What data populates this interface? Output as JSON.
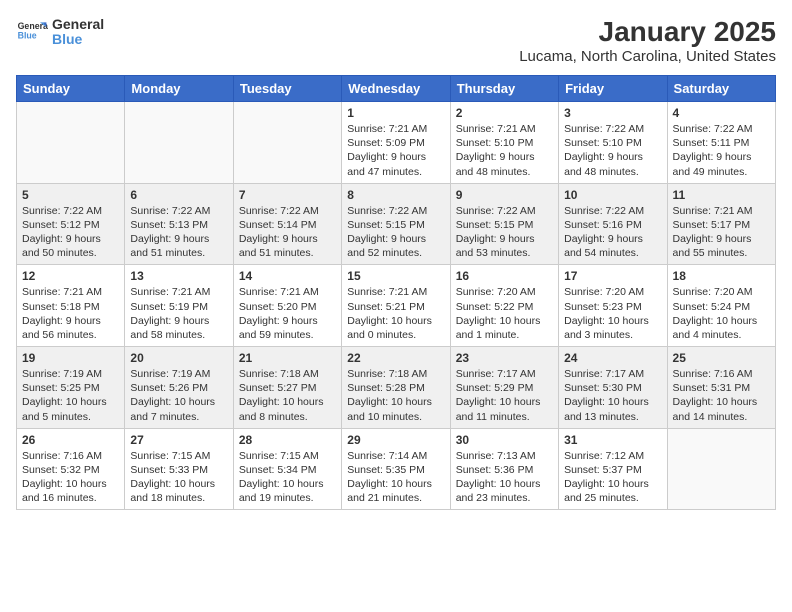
{
  "header": {
    "logo_line1": "General",
    "logo_line2": "Blue",
    "title": "January 2025",
    "subtitle": "Lucama, North Carolina, United States"
  },
  "days_of_week": [
    "Sunday",
    "Monday",
    "Tuesday",
    "Wednesday",
    "Thursday",
    "Friday",
    "Saturday"
  ],
  "weeks": [
    [
      {
        "day": "",
        "content": ""
      },
      {
        "day": "",
        "content": ""
      },
      {
        "day": "",
        "content": ""
      },
      {
        "day": "1",
        "content": "Sunrise: 7:21 AM\nSunset: 5:09 PM\nDaylight: 9 hours and 47 minutes."
      },
      {
        "day": "2",
        "content": "Sunrise: 7:21 AM\nSunset: 5:10 PM\nDaylight: 9 hours and 48 minutes."
      },
      {
        "day": "3",
        "content": "Sunrise: 7:22 AM\nSunset: 5:10 PM\nDaylight: 9 hours and 48 minutes."
      },
      {
        "day": "4",
        "content": "Sunrise: 7:22 AM\nSunset: 5:11 PM\nDaylight: 9 hours and 49 minutes."
      }
    ],
    [
      {
        "day": "5",
        "content": "Sunrise: 7:22 AM\nSunset: 5:12 PM\nDaylight: 9 hours and 50 minutes."
      },
      {
        "day": "6",
        "content": "Sunrise: 7:22 AM\nSunset: 5:13 PM\nDaylight: 9 hours and 51 minutes."
      },
      {
        "day": "7",
        "content": "Sunrise: 7:22 AM\nSunset: 5:14 PM\nDaylight: 9 hours and 51 minutes."
      },
      {
        "day": "8",
        "content": "Sunrise: 7:22 AM\nSunset: 5:15 PM\nDaylight: 9 hours and 52 minutes."
      },
      {
        "day": "9",
        "content": "Sunrise: 7:22 AM\nSunset: 5:15 PM\nDaylight: 9 hours and 53 minutes."
      },
      {
        "day": "10",
        "content": "Sunrise: 7:22 AM\nSunset: 5:16 PM\nDaylight: 9 hours and 54 minutes."
      },
      {
        "day": "11",
        "content": "Sunrise: 7:21 AM\nSunset: 5:17 PM\nDaylight: 9 hours and 55 minutes."
      }
    ],
    [
      {
        "day": "12",
        "content": "Sunrise: 7:21 AM\nSunset: 5:18 PM\nDaylight: 9 hours and 56 minutes."
      },
      {
        "day": "13",
        "content": "Sunrise: 7:21 AM\nSunset: 5:19 PM\nDaylight: 9 hours and 58 minutes."
      },
      {
        "day": "14",
        "content": "Sunrise: 7:21 AM\nSunset: 5:20 PM\nDaylight: 9 hours and 59 minutes."
      },
      {
        "day": "15",
        "content": "Sunrise: 7:21 AM\nSunset: 5:21 PM\nDaylight: 10 hours and 0 minutes."
      },
      {
        "day": "16",
        "content": "Sunrise: 7:20 AM\nSunset: 5:22 PM\nDaylight: 10 hours and 1 minute."
      },
      {
        "day": "17",
        "content": "Sunrise: 7:20 AM\nSunset: 5:23 PM\nDaylight: 10 hours and 3 minutes."
      },
      {
        "day": "18",
        "content": "Sunrise: 7:20 AM\nSunset: 5:24 PM\nDaylight: 10 hours and 4 minutes."
      }
    ],
    [
      {
        "day": "19",
        "content": "Sunrise: 7:19 AM\nSunset: 5:25 PM\nDaylight: 10 hours and 5 minutes."
      },
      {
        "day": "20",
        "content": "Sunrise: 7:19 AM\nSunset: 5:26 PM\nDaylight: 10 hours and 7 minutes."
      },
      {
        "day": "21",
        "content": "Sunrise: 7:18 AM\nSunset: 5:27 PM\nDaylight: 10 hours and 8 minutes."
      },
      {
        "day": "22",
        "content": "Sunrise: 7:18 AM\nSunset: 5:28 PM\nDaylight: 10 hours and 10 minutes."
      },
      {
        "day": "23",
        "content": "Sunrise: 7:17 AM\nSunset: 5:29 PM\nDaylight: 10 hours and 11 minutes."
      },
      {
        "day": "24",
        "content": "Sunrise: 7:17 AM\nSunset: 5:30 PM\nDaylight: 10 hours and 13 minutes."
      },
      {
        "day": "25",
        "content": "Sunrise: 7:16 AM\nSunset: 5:31 PM\nDaylight: 10 hours and 14 minutes."
      }
    ],
    [
      {
        "day": "26",
        "content": "Sunrise: 7:16 AM\nSunset: 5:32 PM\nDaylight: 10 hours and 16 minutes."
      },
      {
        "day": "27",
        "content": "Sunrise: 7:15 AM\nSunset: 5:33 PM\nDaylight: 10 hours and 18 minutes."
      },
      {
        "day": "28",
        "content": "Sunrise: 7:15 AM\nSunset: 5:34 PM\nDaylight: 10 hours and 19 minutes."
      },
      {
        "day": "29",
        "content": "Sunrise: 7:14 AM\nSunset: 5:35 PM\nDaylight: 10 hours and 21 minutes."
      },
      {
        "day": "30",
        "content": "Sunrise: 7:13 AM\nSunset: 5:36 PM\nDaylight: 10 hours and 23 minutes."
      },
      {
        "day": "31",
        "content": "Sunrise: 7:12 AM\nSunset: 5:37 PM\nDaylight: 10 hours and 25 minutes."
      },
      {
        "day": "",
        "content": ""
      }
    ]
  ],
  "colors": {
    "header_bg": "#3a6cc8",
    "row_shaded": "#f0f0f0",
    "row_white": "#ffffff"
  }
}
